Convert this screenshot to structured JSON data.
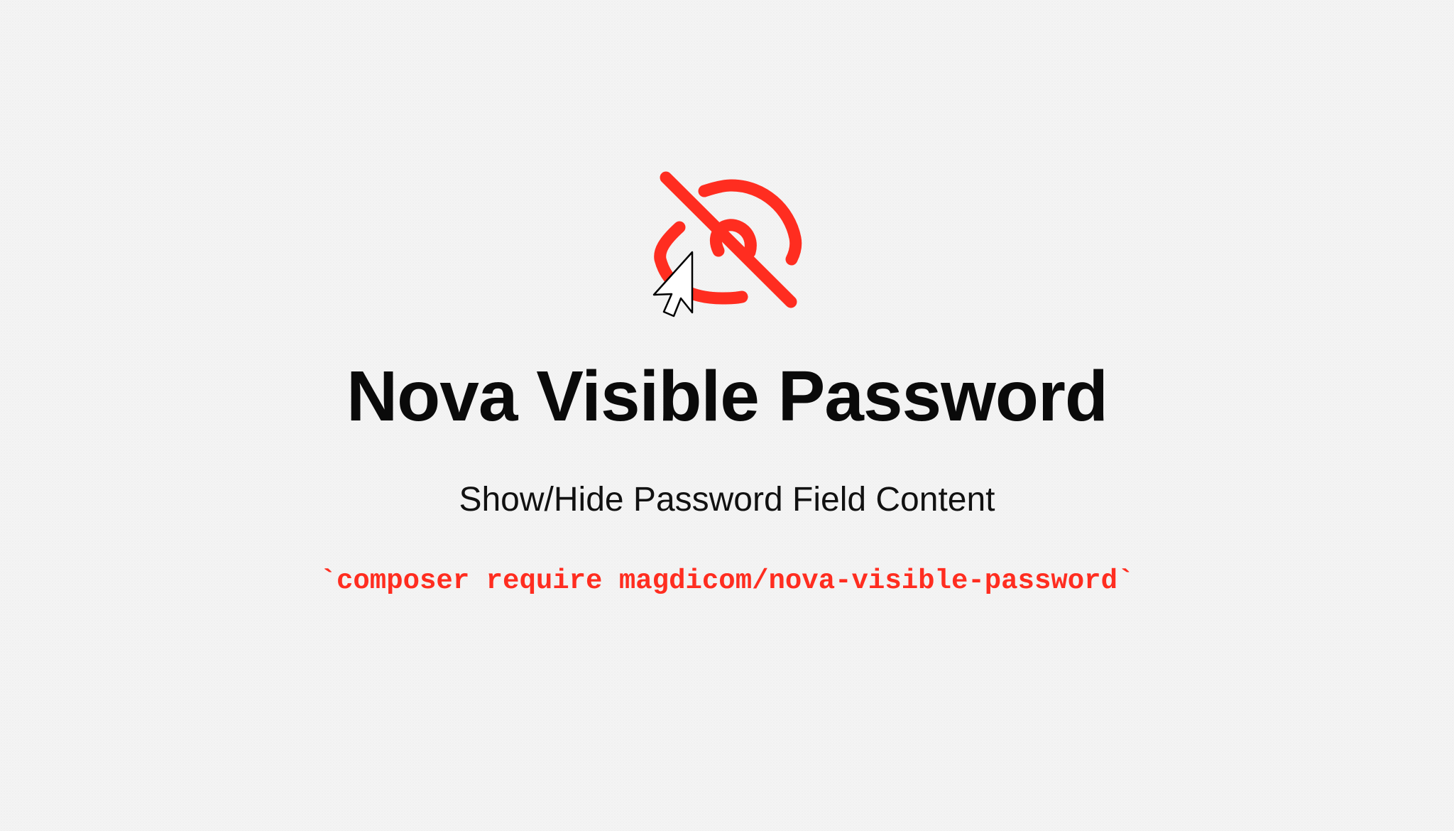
{
  "hero": {
    "icons": {
      "main": "eye-slash-icon",
      "pointer": "mouse-pointer-icon"
    },
    "title": "Nova Visible Password",
    "subtitle": "Show/Hide Password Field Content",
    "install_command": "`composer require magdicom/nova-visible-password`"
  },
  "colors": {
    "accent": "#ff2d20",
    "title": "#0a0a0a",
    "subtitle": "#111111",
    "background": "#f4f4f4"
  }
}
